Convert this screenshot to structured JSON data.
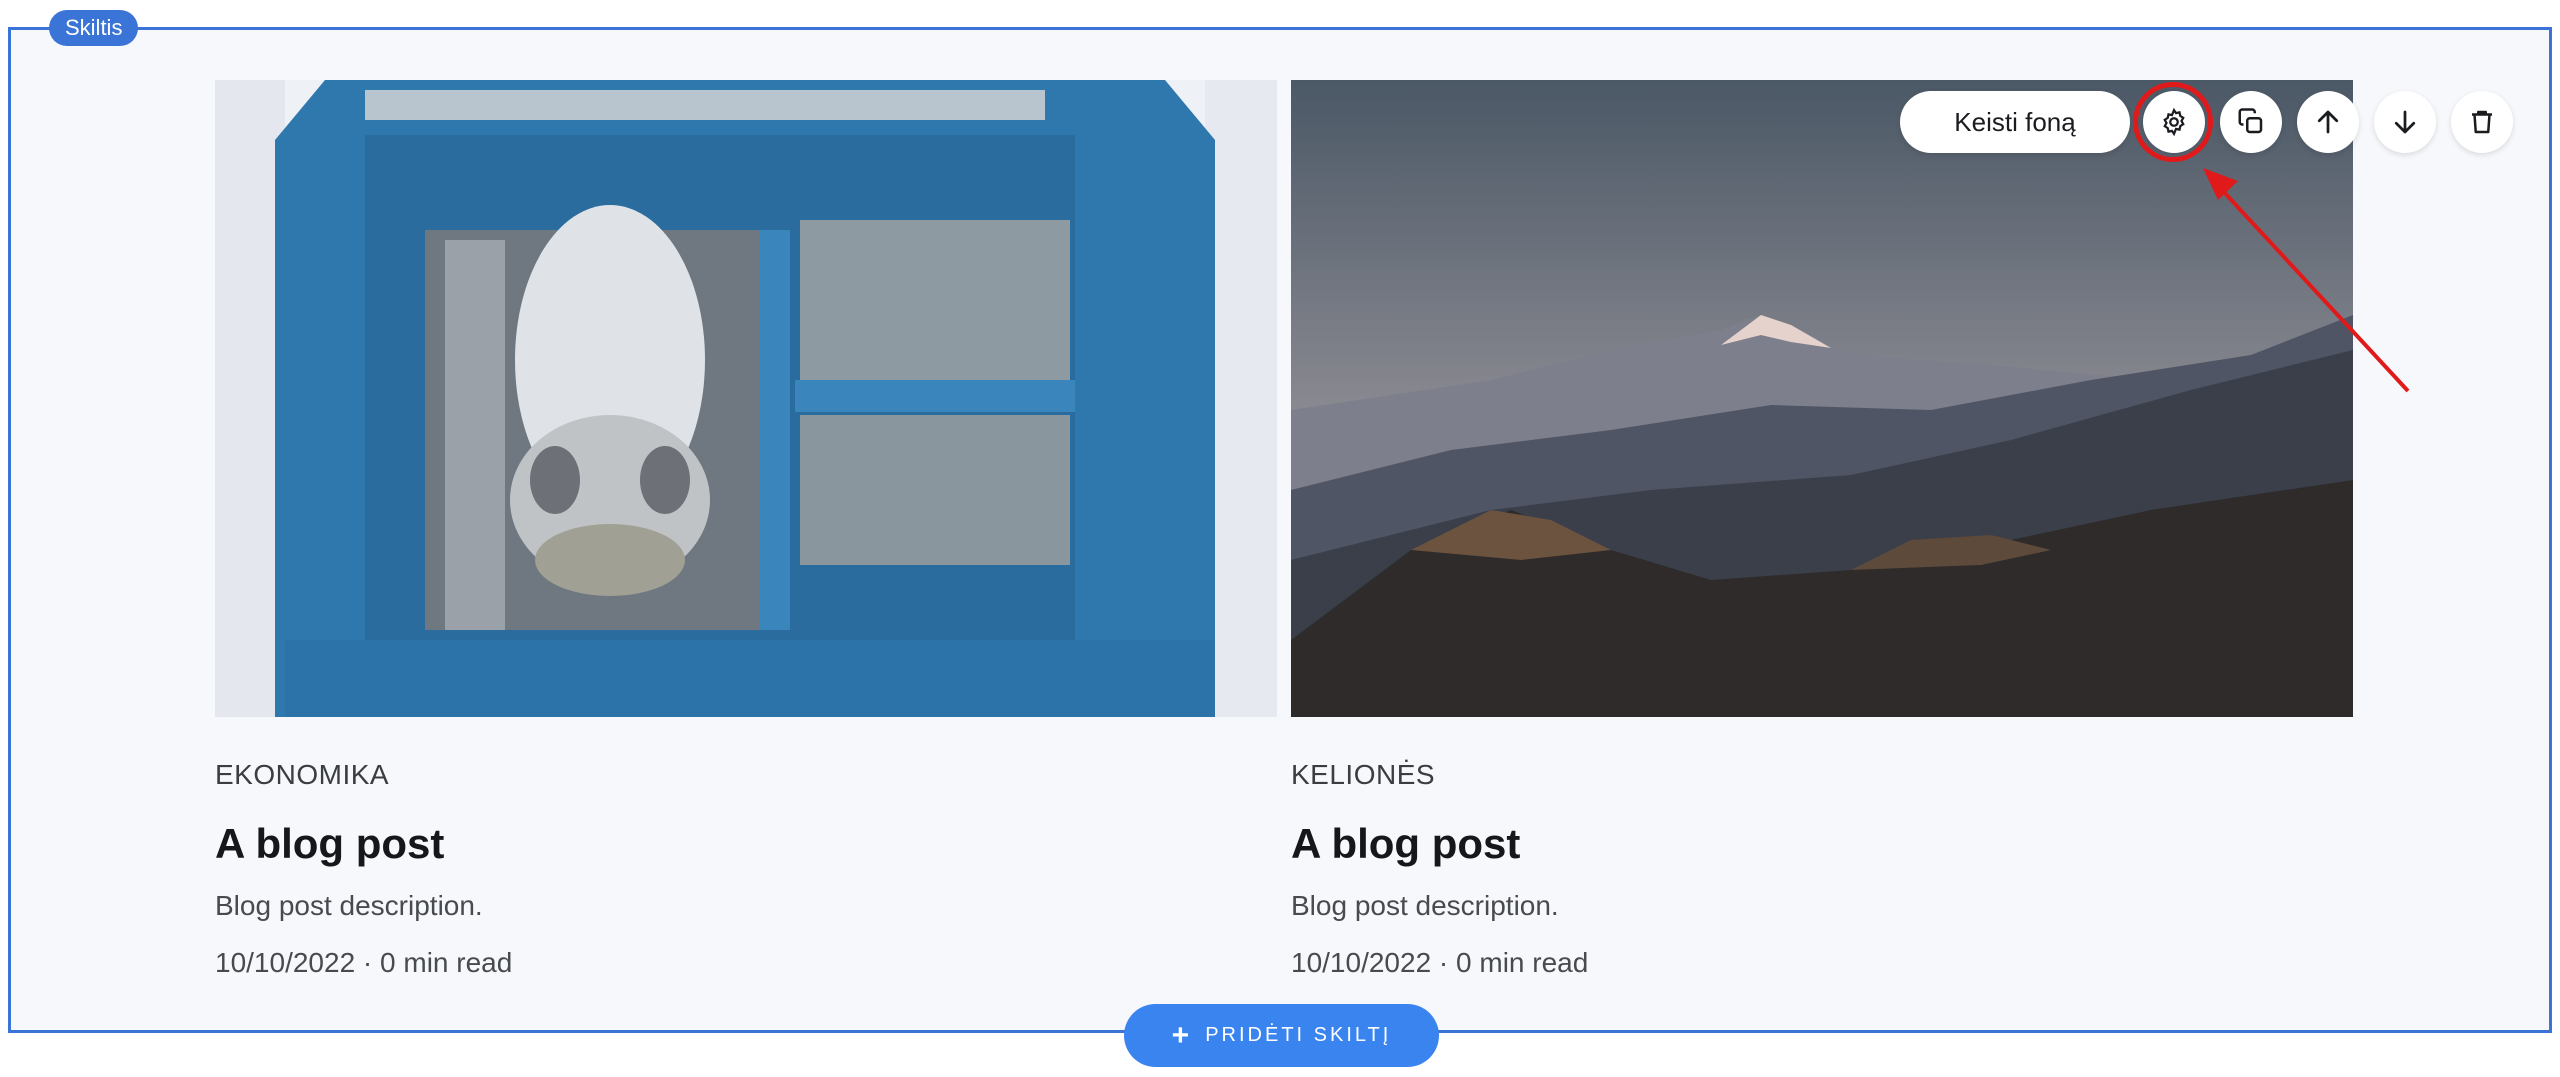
{
  "section": {
    "tag_label": "Skiltis"
  },
  "posts": [
    {
      "category": "EKONOMIKA",
      "title": "A blog post",
      "description": "Blog post description.",
      "meta": "10/10/2022 · 0 min read"
    },
    {
      "category": "KELIONĖS",
      "title": "A blog post",
      "description": "Blog post description.",
      "meta": "10/10/2022 · 0 min read"
    }
  ],
  "toolbar": {
    "change_background_label": "Keisti foną",
    "icons": [
      "gear-icon",
      "duplicate-icon",
      "arrow-up-icon",
      "arrow-down-icon",
      "trash-icon"
    ]
  },
  "add_section": {
    "label": "PRIDĖTI SKILTĮ",
    "icon": "plus-icon"
  },
  "colors": {
    "accent": "#3a74d6",
    "add_button": "#3a84f0",
    "annotation": "#e01a1a",
    "section_bg": "#f6f8fb"
  }
}
